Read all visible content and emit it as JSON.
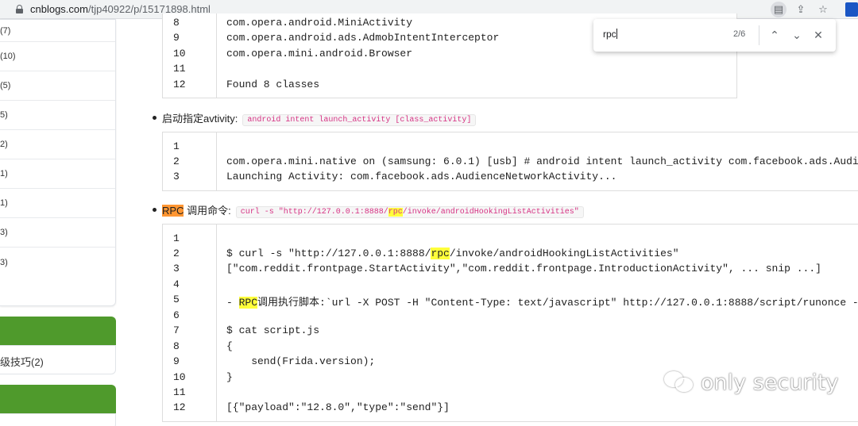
{
  "browser": {
    "url_host": "cnblogs.com",
    "url_path": "/tjp40922/p/15171898.html",
    "icons": [
      "lock-icon",
      "reader-icon",
      "share-icon",
      "bookmark-star-icon",
      "extension-icon"
    ]
  },
  "find_bar": {
    "query": "rpc",
    "match_count": "2/6",
    "icons": [
      "previous-match-icon",
      "next-match-icon",
      "close-icon"
    ]
  },
  "sidebar": {
    "counts": [
      "(7)",
      "(10)",
      "(5)",
      "5)",
      "2)",
      "1)",
      "1)",
      "3)",
      "3)"
    ],
    "item_label": "级技巧(2)"
  },
  "block1": {
    "lines": [
      {
        "n": "8",
        "t": "com.opera.android.MiniActivity"
      },
      {
        "n": "9",
        "t": "com.opera.android.ads.AdmobIntentInterceptor"
      },
      {
        "n": "10",
        "t": "com.opera.mini.android.Browser"
      },
      {
        "n": "11",
        "t": ""
      },
      {
        "n": "12",
        "t": "Found 8 classes"
      }
    ]
  },
  "bullet1": {
    "label": "启动指定avtivity:",
    "code": "android intent launch_activity [class_activity]"
  },
  "block2": {
    "lines": [
      {
        "n": "1",
        "t": ""
      },
      {
        "n": "2",
        "t": "com.opera.mini.native on (samsung: 6.0.1) [usb] # android intent launch_activity com.facebook.ads.AudienceNetworkActivity"
      },
      {
        "n": "3",
        "t": "Launching Activity: com.facebook.ads.AudienceNetworkActivity..."
      }
    ]
  },
  "bullet2": {
    "label_hl": "RPC",
    "label_rest": " 调用命令:",
    "code_pre": "curl -s \"http://127.0.0.1:8888/",
    "code_hl": "rpc",
    "code_post": "/invoke/androidHookingListActivities\""
  },
  "block3": {
    "lines": [
      {
        "n": "1",
        "pre": "",
        "hl": "",
        "post": ""
      },
      {
        "n": "2",
        "pre": "$ curl -s \"http://127.0.0.1:8888/",
        "hl": "rpc",
        "post": "/invoke/androidHookingListActivities\""
      },
      {
        "n": "3",
        "pre": "[\"com.reddit.frontpage.StartActivity\",\"com.reddit.frontpage.IntroductionActivity\", ... snip ...]",
        "hl": "",
        "post": ""
      },
      {
        "n": "4",
        "pre": "",
        "hl": "",
        "post": ""
      },
      {
        "n": "5",
        "pre": "- ",
        "hl": "RPC",
        "post": "调用执行脚本:`url -X POST -H \"Content-Type: text/javascript\" http://127.0.0.1:8888/script/runonce -d \"@script.js\"`"
      },
      {
        "n": "6",
        "pre": "",
        "hl": "",
        "post": ""
      },
      {
        "n": "7",
        "pre": "$ cat script.js",
        "hl": "",
        "post": ""
      },
      {
        "n": "8",
        "pre": "{",
        "hl": "",
        "post": ""
      },
      {
        "n": "9",
        "pre": "    send(Frida.version);",
        "hl": "",
        "post": ""
      },
      {
        "n": "10",
        "pre": "}",
        "hl": "",
        "post": ""
      },
      {
        "n": "11",
        "pre": "",
        "hl": "",
        "post": ""
      },
      {
        "n": "12",
        "pre": "[{\"payload\":\"12.8.0\",\"type\":\"send\"}]",
        "hl": "",
        "post": ""
      }
    ]
  },
  "watermark": {
    "text": "only security"
  },
  "colors": {
    "accent_green": "#4f9a2c",
    "find_highlight": "#ffff3a",
    "current_match": "#ff9632",
    "inline_code": "#d63384"
  }
}
